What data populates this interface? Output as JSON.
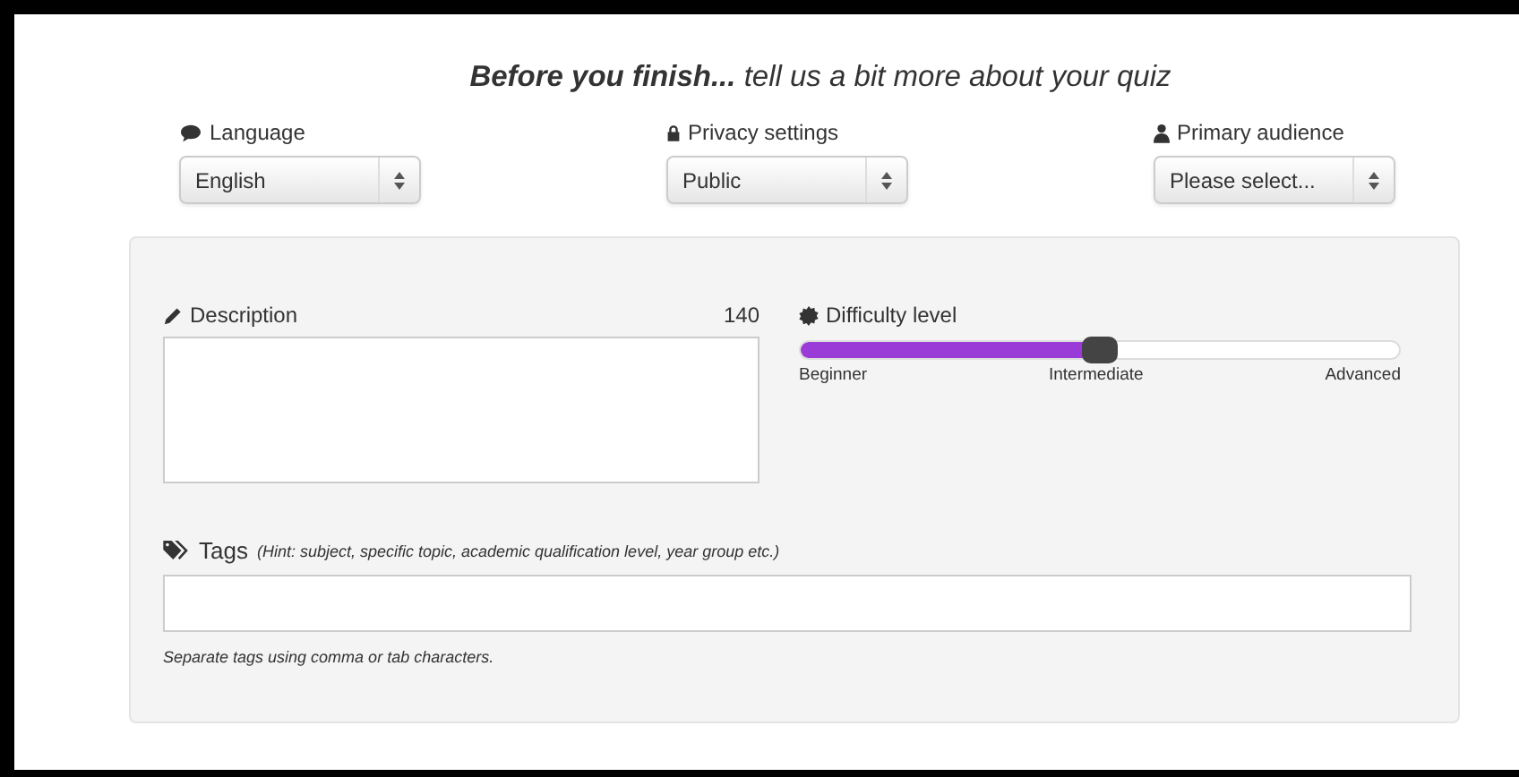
{
  "heading": "**Before you finish...** tell us a bit more about your quiz",
  "selects": [
    {
      "label": "Language",
      "kind": "speech",
      "value": "English"
    },
    {
      "label": "Privacy settings",
      "kind": "lock",
      "value": "Public"
    },
    {
      "label": "Primary audience",
      "kind": "person",
      "value": "Please select..."
    }
  ],
  "description": {
    "label": "Description",
    "counter": "140"
  },
  "difficulty": {
    "label": "Difficulty level",
    "level": 0.5,
    "ticks": [
      "Beginner",
      "Intermediate",
      "Advanced"
    ]
  },
  "tags": {
    "label": "Tags",
    "hint": "(Hint: subject, specific topic, academic qualification level, year group etc.)",
    "help": "Separate tags using comma or tab characters."
  }
}
